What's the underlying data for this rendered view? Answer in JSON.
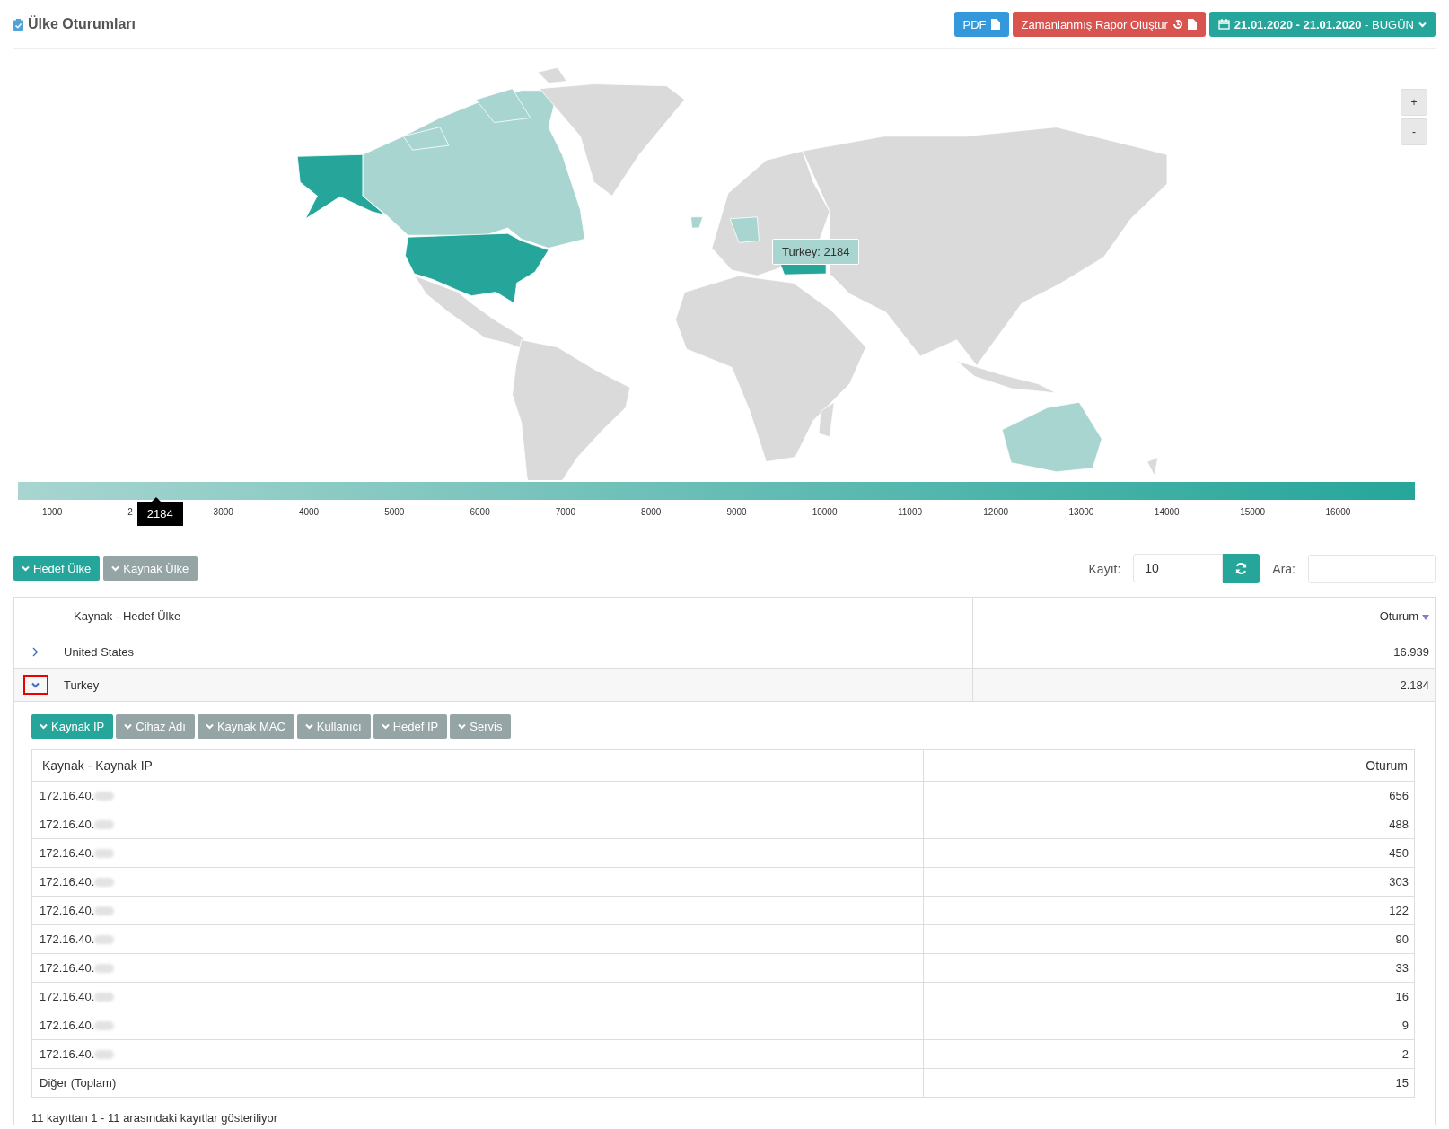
{
  "header": {
    "title": "Ülke Oturumları",
    "buttons": [
      {
        "kind": "pdf",
        "label": "PDF"
      },
      {
        "kind": "schedule",
        "label": "Zamanlanmış Rapor Oluştur"
      },
      {
        "kind": "date",
        "label": "**21.01.2020 - 21.01.2020** - BUGÜN"
      }
    ]
  },
  "map": {
    "zoom_buttons": [
      "+",
      "-"
    ],
    "tooltip": "Turkey: 2184",
    "legend": {
      "ticks": [
        "1000",
        "2",
        "3000",
        "4000",
        "5000",
        "6000",
        "7000",
        "8000",
        "9000",
        "10000",
        "11000",
        "12000",
        "13000",
        "14000",
        "15000",
        "16000"
      ],
      "marker": {
        "label": "2184"
      }
    }
  },
  "group_buttons": [
    {
      "label": "Hedef Ülke",
      "selected": true
    },
    {
      "label": "Kaynak Ülke",
      "selected": false
    }
  ],
  "page_size": {
    "label": "Kayıt:",
    "value": "10"
  },
  "search": {
    "label": "Ara:"
  },
  "table": {
    "columns": [
      "Kaynak - Hedef Ülke",
      "Oturum"
    ],
    "rows": [
      {
        "country": "United States",
        "sessions": "16.939",
        "expanded": false,
        "marked": false
      },
      {
        "country": "Turkey",
        "sessions": "2.184",
        "expanded": true,
        "marked": true
      }
    ]
  },
  "detail": {
    "buttons": [
      {
        "label": "Kaynak IP",
        "selected": true
      },
      {
        "label": "Cihaz Adı",
        "selected": false
      },
      {
        "label": "Kaynak MAC",
        "selected": false
      },
      {
        "label": "Kullanıcı",
        "selected": false
      },
      {
        "label": "Hedef IP",
        "selected": false
      },
      {
        "label": "Servis",
        "selected": false
      }
    ],
    "columns": [
      "Kaynak - Kaynak IP",
      "Oturum"
    ],
    "rows": [
      {
        "ip": "172.16.40.",
        "redacted": true,
        "sessions": "656"
      },
      {
        "ip": "172.16.40.",
        "redacted": true,
        "sessions": "488"
      },
      {
        "ip": "172.16.40.",
        "redacted": true,
        "sessions": "450"
      },
      {
        "ip": "172.16.40.",
        "redacted": true,
        "sessions": "303"
      },
      {
        "ip": "172.16.40.",
        "redacted": true,
        "sessions": "122"
      },
      {
        "ip": "172.16.40.",
        "redacted": true,
        "sessions": "90"
      },
      {
        "ip": "172.16.40.",
        "redacted": true,
        "sessions": "33"
      },
      {
        "ip": "172.16.40.",
        "redacted": true,
        "sessions": "16"
      },
      {
        "ip": "172.16.40.",
        "redacted": true,
        "sessions": "9"
      },
      {
        "ip": "172.16.40.",
        "redacted": true,
        "sessions": "2"
      },
      {
        "ip": "Diğer (Toplam)",
        "redacted": false,
        "sessions": "15"
      }
    ],
    "footer": "11 kayıttan 1 - 11 arasındaki kayıtlar gösteriliyor"
  }
}
